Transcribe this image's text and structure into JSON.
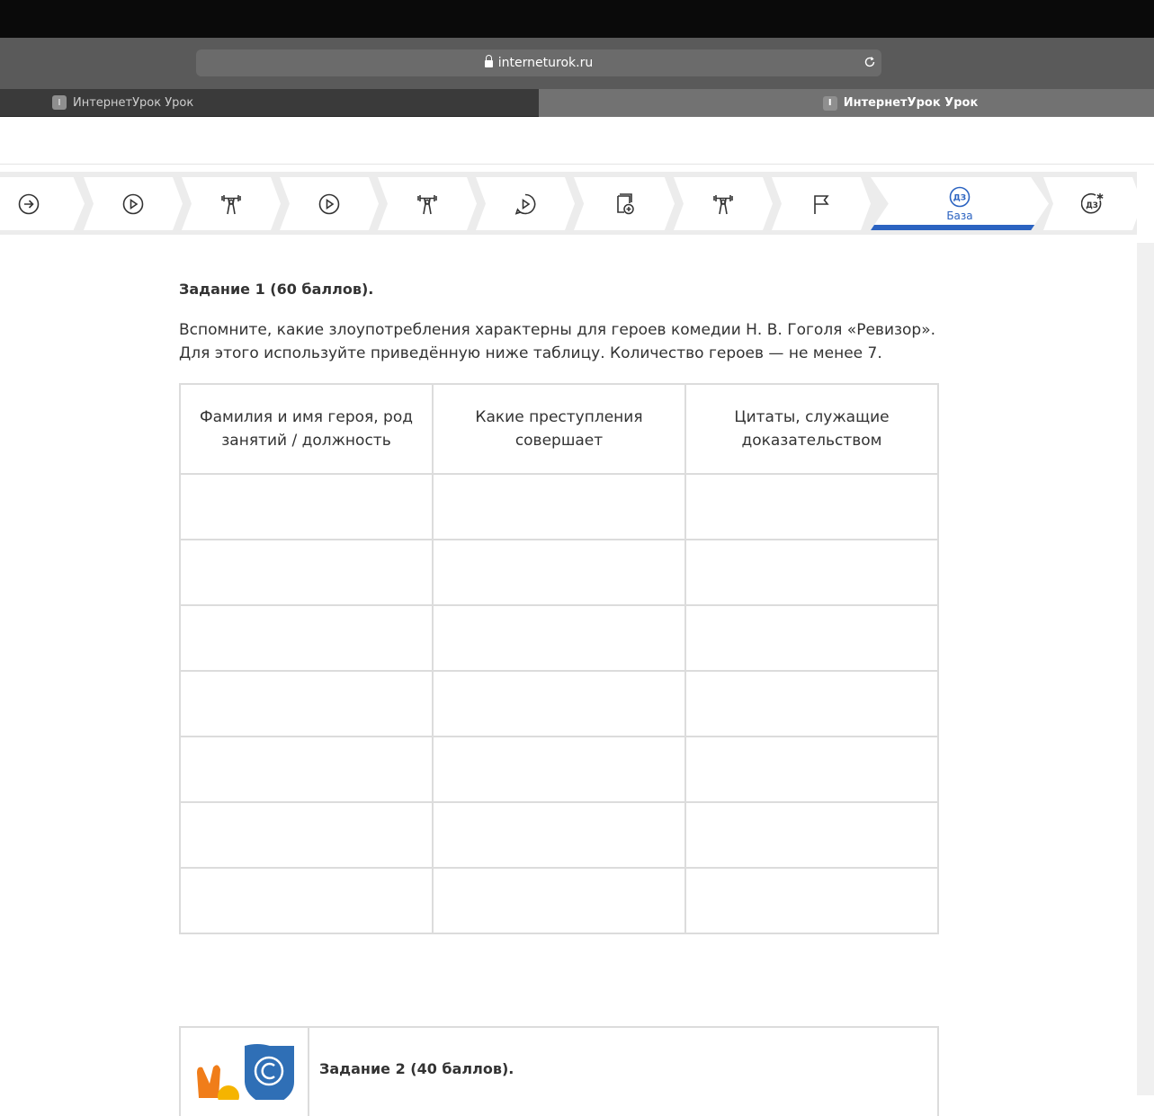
{
  "browser": {
    "url": "interneturok.ru",
    "tabs": [
      {
        "title": "ИнтернетУрок Урок",
        "favicon": "I",
        "active": false
      },
      {
        "title": "ИнтернетУрок Урок",
        "favicon": "I",
        "active": true
      }
    ]
  },
  "steps": {
    "active_label": "База",
    "active_badge": "ДЗ",
    "icons": [
      "arrow-right-circle-icon",
      "play-circle-icon",
      "weightlifter-icon",
      "play-circle-icon",
      "weightlifter-icon",
      "play-chat-icon",
      "book-plus-icon",
      "weightlifter-icon",
      "flag-icon",
      "homework-base-icon",
      "homework-star-icon"
    ]
  },
  "task1": {
    "title": "Задание 1 (60 баллов).",
    "text": "Вспомните, какие злоупотребления характерны для героев комедии Н. В. Гоголя «Ревизор». Для этого используйте приведённую ниже таблицу. Количество героев — не менее 7.",
    "table": {
      "headers": [
        "Фамилия и имя героя, род занятий / должность",
        "Какие преступления совершает",
        "Цитаты, служащие доказательством"
      ],
      "row_count": 7
    }
  },
  "task2": {
    "title": "Задание 2 (40 баллов)."
  },
  "colors": {
    "accent": "#2b63c1"
  }
}
